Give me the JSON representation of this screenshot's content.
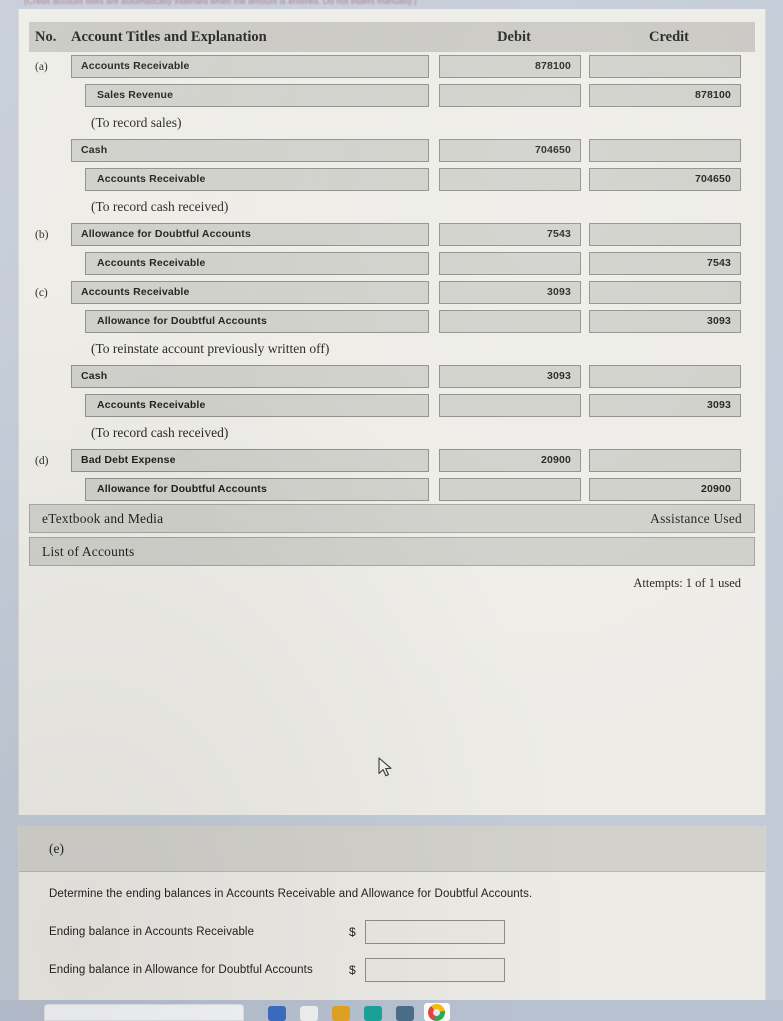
{
  "top_cut_text": "(Credit account titles are automatically indented when the amount is entered. Do not indent manually.)",
  "journal": {
    "headers": {
      "no": "No.",
      "account": "Account Titles and Explanation",
      "debit": "Debit",
      "credit": "Credit"
    },
    "rows": [
      {
        "kind": "entry",
        "no": "(a)",
        "account": "Accounts Receivable",
        "indent": false,
        "debit": "878100",
        "credit": ""
      },
      {
        "kind": "entry",
        "no": "",
        "account": "Sales Revenue",
        "indent": true,
        "debit": "",
        "credit": "878100"
      },
      {
        "kind": "explanation",
        "text": "(To record sales)"
      },
      {
        "kind": "entry",
        "no": "",
        "account": "Cash",
        "indent": false,
        "debit": "704650",
        "credit": ""
      },
      {
        "kind": "entry",
        "no": "",
        "account": "Accounts Receivable",
        "indent": true,
        "debit": "",
        "credit": "704650"
      },
      {
        "kind": "explanation",
        "text": "(To record cash received)"
      },
      {
        "kind": "entry",
        "no": "(b)",
        "account": "Allowance for Doubtful Accounts",
        "indent": false,
        "debit": "7543",
        "credit": ""
      },
      {
        "kind": "entry",
        "no": "",
        "account": "Accounts Receivable",
        "indent": true,
        "debit": "",
        "credit": "7543"
      },
      {
        "kind": "entry",
        "no": "(c)",
        "account": "Accounts Receivable",
        "indent": false,
        "debit": "3093",
        "credit": ""
      },
      {
        "kind": "entry",
        "no": "",
        "account": "Allowance for Doubtful Accounts",
        "indent": true,
        "debit": "",
        "credit": "3093"
      },
      {
        "kind": "explanation",
        "text": "(To reinstate account previously written off)"
      },
      {
        "kind": "entry",
        "no": "",
        "account": "Cash",
        "indent": false,
        "debit": "3093",
        "credit": ""
      },
      {
        "kind": "entry",
        "no": "",
        "account": "Accounts Receivable",
        "indent": true,
        "debit": "",
        "credit": "3093"
      },
      {
        "kind": "explanation",
        "text": "(To record cash received)"
      },
      {
        "kind": "entry",
        "no": "(d)",
        "account": "Bad Debt Expense",
        "indent": false,
        "debit": "20900",
        "credit": ""
      },
      {
        "kind": "entry",
        "no": "",
        "account": "Allowance for Doubtful Accounts",
        "indent": true,
        "debit": "",
        "credit": "20900"
      }
    ]
  },
  "footer": {
    "etextbook_label": "eTextbook and Media",
    "assistance_label": "Assistance Used",
    "list_of_accounts_label": "List of Accounts",
    "attempts_text": "Attempts: 1 of 1 used"
  },
  "part_e": {
    "label": "(e)",
    "prompt": "Determine the ending balances in Accounts Receivable and Allowance for Doubtful Accounts.",
    "fields": [
      {
        "label": "Ending balance in Accounts Receivable",
        "currency": "$",
        "value": ""
      },
      {
        "label": "Ending balance in Allowance for Doubtful Accounts",
        "currency": "$",
        "value": ""
      }
    ]
  },
  "taskbar": {
    "icons": [
      {
        "name": "blue-app-icon",
        "color": "#3b6fc4"
      },
      {
        "name": "white-app-icon",
        "color": "#f1f2f2"
      },
      {
        "name": "folder-icon",
        "color": "#e3a424"
      },
      {
        "name": "teal-app-icon",
        "color": "#1aa49a"
      },
      {
        "name": "printer-icon",
        "color": "#4a6e8c"
      },
      {
        "name": "chrome-icon",
        "color": "#e8453c"
      }
    ]
  },
  "colors": {
    "page_bg": "#edece7",
    "header_bar": "#c8c7c2",
    "field_bg": "#cfcfca",
    "field_border": "#8e8e88",
    "desktop": "#c3cbd8"
  }
}
